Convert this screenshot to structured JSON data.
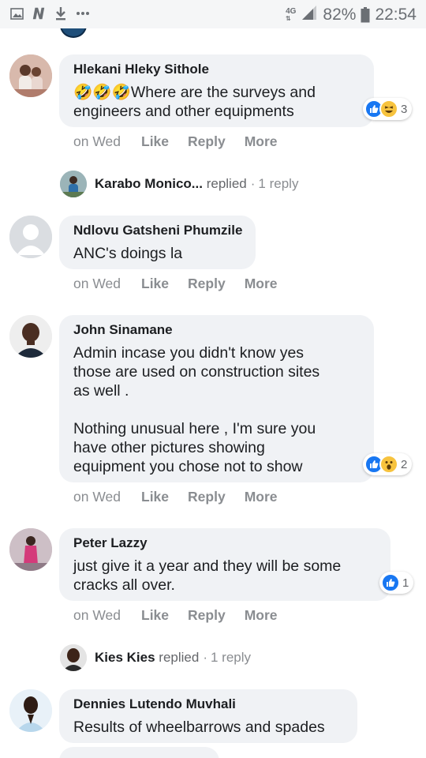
{
  "status_bar": {
    "network": "4G",
    "battery": "82%",
    "time": "22:54",
    "left_icons": [
      "image-icon",
      "n-app-icon",
      "download-icon",
      "more-dots"
    ]
  },
  "comments": [
    {
      "author": "Hlekani Hleky Sithole",
      "text_lines": [
        "🤣🤣🤣Where are the surveys and",
        "engineers and other equipments"
      ],
      "time": "on Wed",
      "reactions": {
        "types": [
          "like",
          "haha"
        ],
        "count": "3"
      }
    },
    {
      "author": "Ndlovu Gatsheni Phumzile",
      "text_lines": [
        "ANC's doings la"
      ],
      "time": "on Wed"
    },
    {
      "author": "John Sinamane",
      "text_lines": [
        "Admin incase you didn't know yes",
        "those are used on construction sites",
        "as well .",
        "",
        "Nothing unusual here , I'm sure you",
        "have other pictures showing",
        "equipment you chose not to show"
      ],
      "time": "on Wed",
      "reactions": {
        "types": [
          "like",
          "wow"
        ],
        "count": "2"
      }
    },
    {
      "author": "Peter Lazzy",
      "text_lines": [
        "just give it a year and they will be some",
        "cracks all over."
      ],
      "time": "on Wed",
      "reactions": {
        "types": [
          "like"
        ],
        "count": "1"
      }
    },
    {
      "author": "Dennies Lutendo Muvhali",
      "text_lines": [
        "Results of wheelbarrows and spades"
      ]
    }
  ],
  "replies": [
    {
      "name": "Karabo Monico...",
      "verb": "replied",
      "sep": "·",
      "count": "1 reply"
    },
    {
      "name": "Kies Kies",
      "verb": "replied",
      "sep": "·",
      "count": "1 reply"
    }
  ],
  "actions": {
    "like": "Like",
    "reply": "Reply",
    "more": "More"
  }
}
